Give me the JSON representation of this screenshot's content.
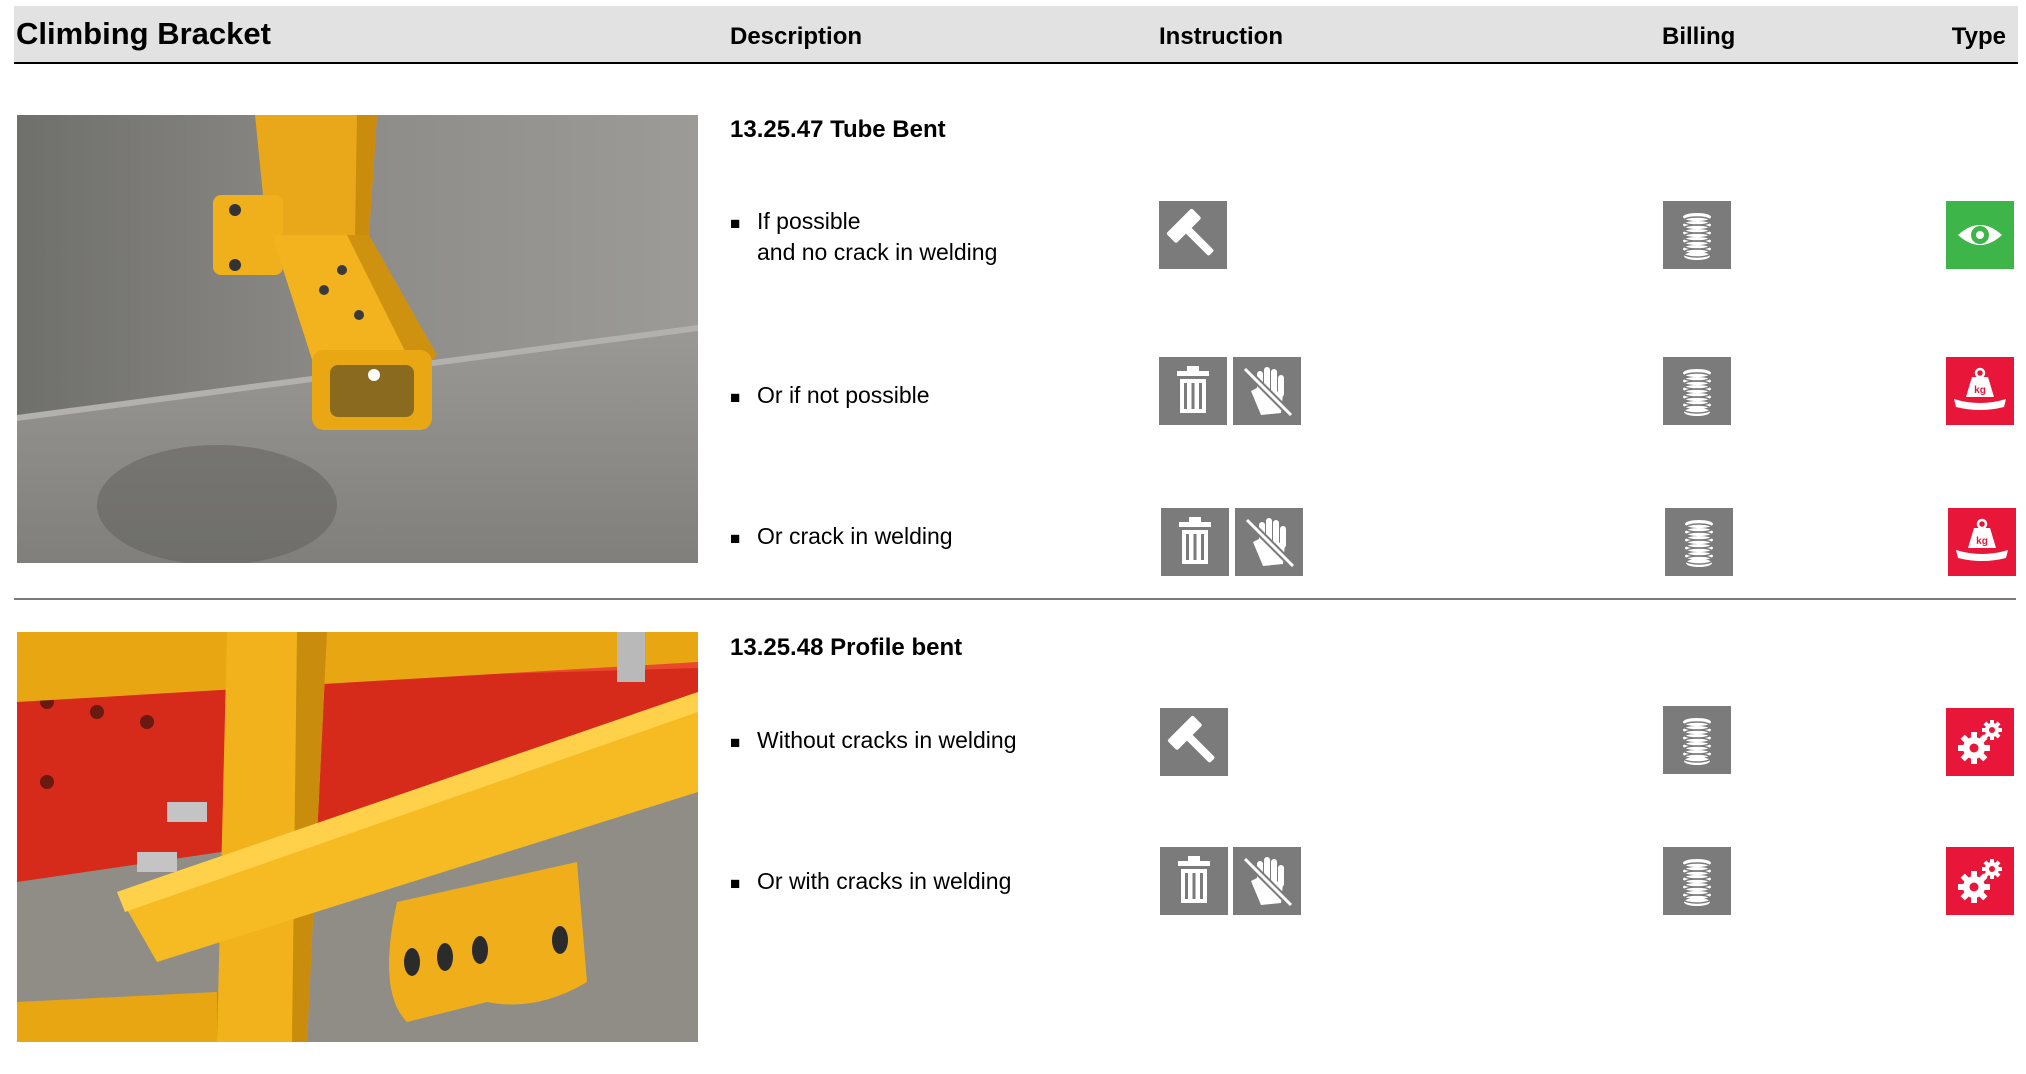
{
  "header": {
    "title": "Climbing Bracket",
    "columns": {
      "description": "Description",
      "instruction": "Instruction",
      "billing": "Billing",
      "type": "Type"
    }
  },
  "colors": {
    "header_bg": "#e2e2e2",
    "icon_gray": "#7b7b7b",
    "type_green": "#3db549",
    "type_red": "#e8173a"
  },
  "sections": [
    {
      "title": "13.25.47 Tube Bent",
      "photo": "yellow tube bracket mounted on concrete wall",
      "items": [
        {
          "bullet": "■",
          "text": "If possible\nand no crack in welding",
          "instruction_icons": [
            "hammer-icon"
          ],
          "billing_icon": "coins-icon",
          "type_icon": "eye-icon",
          "type_color": "green"
        },
        {
          "bullet": "■",
          "text": "Or if not possible",
          "instruction_icons": [
            "trash-icon",
            "no-hand-icon"
          ],
          "billing_icon": "coins-icon",
          "type_icon": "scrap-weight-icon",
          "type_color": "red"
        },
        {
          "bullet": "■",
          "text": "Or crack in welding",
          "instruction_icons": [
            "trash-icon",
            "no-hand-icon"
          ],
          "billing_icon": "coins-icon",
          "type_icon": "scrap-weight-icon",
          "type_color": "red"
        }
      ]
    },
    {
      "title": "13.25.48 Profile bent",
      "photo": "yellow profile bracket bolted to red beam",
      "items": [
        {
          "bullet": "■",
          "text": "Without cracks in welding",
          "instruction_icons": [
            "hammer-icon"
          ],
          "billing_icon": "coins-icon",
          "type_icon": "gears-icon",
          "type_color": "red"
        },
        {
          "bullet": "■",
          "text": "Or with cracks in welding",
          "instruction_icons": [
            "trash-icon",
            "no-hand-icon"
          ],
          "billing_icon": "coins-icon",
          "type_icon": "gears-icon",
          "type_color": "red"
        }
      ]
    }
  ],
  "weight_label": "kg"
}
